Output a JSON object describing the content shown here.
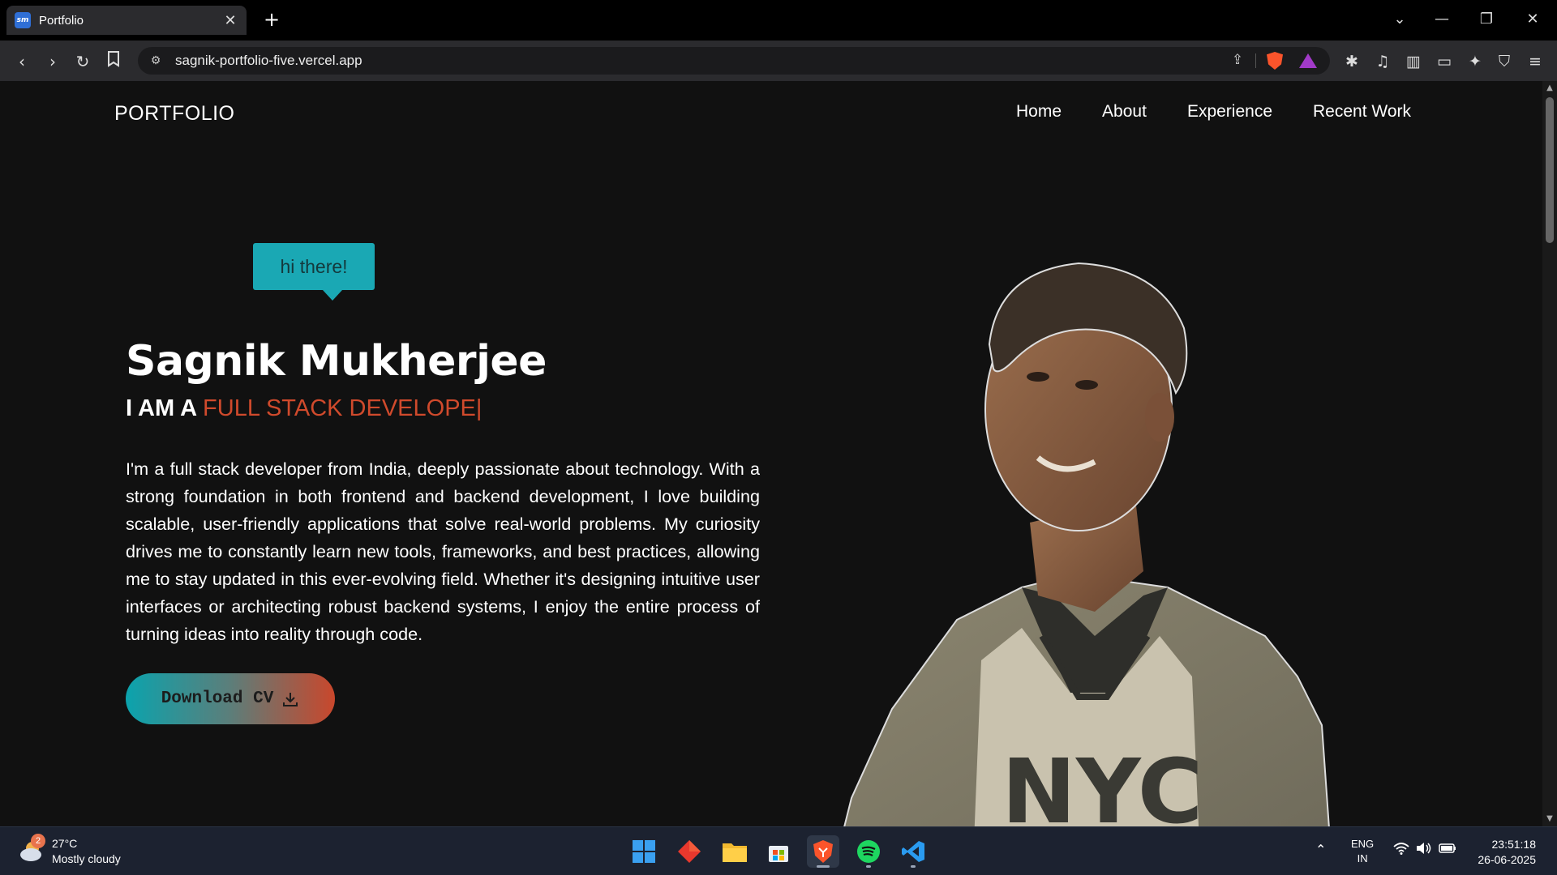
{
  "browser": {
    "tab_title": "Portfolio",
    "favicon_text": "sm",
    "new_tab_label": "+",
    "url": "sagnik-portfolio-five.vercel.app"
  },
  "site": {
    "logo": "PORTFOLIO",
    "nav": [
      {
        "label": "Home"
      },
      {
        "label": "About"
      },
      {
        "label": "Experience"
      },
      {
        "label": "Recent Work"
      }
    ],
    "bubble": "hi there!",
    "name": "Sagnik Mukherjee",
    "role_prefix": "I AM A ",
    "role_typed": "FULL STACK DEVELOPE",
    "caret": "|",
    "description": "I'm a full stack developer from India, deeply passionate about technology. With a strong foundation in both frontend and backend development, I love building scalable, user-friendly applications that solve real-world problems. My curiosity drives me to constantly learn new tools, frameworks, and best practices, allowing me to stay updated in this ever-evolving field. Whether it's designing intuitive user interfaces or architecting robust backend systems, I enjoy the entire process of turning ideas into reality through code.",
    "cv_button": "Download CV",
    "accent_colors": {
      "teal": "#1aa8b4",
      "orange": "#d04a2c"
    }
  },
  "taskbar": {
    "weather_badge": "2",
    "weather_temp": "27°C",
    "weather_desc": "Mostly cloudy",
    "lang_line1": "ENG",
    "lang_line2": "IN",
    "time": "23:51:18",
    "date": "26-06-2025",
    "apps": [
      "windows-start",
      "todo-app",
      "file-explorer",
      "microsoft-store",
      "brave-browser",
      "spotify",
      "vscode"
    ]
  }
}
